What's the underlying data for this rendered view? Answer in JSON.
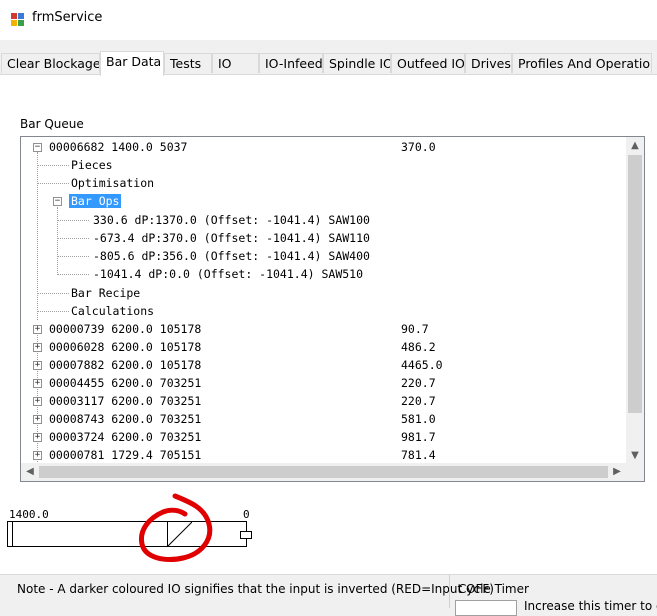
{
  "window": {
    "title": "frmService"
  },
  "tabs": [
    "Clear Blockages",
    "Bar Data",
    "Tests",
    "IO",
    "IO-Infeed",
    "Spindle IO",
    "Outfeed IO",
    "Drives",
    "Profiles And Operations"
  ],
  "active_tab": "Bar Data",
  "bar_queue": {
    "label": "Bar Queue",
    "root": {
      "text": "00006682 1400.0 5037",
      "value": "370.0"
    },
    "children": [
      "Pieces",
      "Optimisation",
      "Bar Ops",
      "Bar Recipe",
      "Calculations"
    ],
    "selected_child": "Bar Ops",
    "bar_ops": [
      "330.6 dP:1370.0 (Offset: -1041.4) SAW100",
      "-673.4 dP:370.0 (Offset: -1041.4) SAW110",
      "-805.6 dP:356.0 (Offset: -1041.4) SAW400",
      "-1041.4 dP:0.0 (Offset: -1041.4) SAW510"
    ],
    "bars": [
      {
        "text": "00000739 6200.0 105178",
        "value": "90.7"
      },
      {
        "text": "00006028 6200.0 105178",
        "value": "486.2"
      },
      {
        "text": "00007882 6200.0 105178",
        "value": "4465.0"
      },
      {
        "text": "00004455 6200.0 703251",
        "value": "220.7"
      },
      {
        "text": "00003117 6200.0 703251",
        "value": "220.7"
      },
      {
        "text": "00008743 6200.0 703251",
        "value": "581.0"
      },
      {
        "text": "00003724 6200.0 703251",
        "value": "981.7"
      },
      {
        "text": "00000781 1729.4 705151",
        "value": "781.4"
      }
    ]
  },
  "bar_graphic": {
    "left_label": "1400.0",
    "right_label": "0"
  },
  "footer": {
    "note": "Note - A darker coloured IO signifies that the input is inverted (RED=Input OFF)",
    "cycle_timer_label": "Cycle Timer",
    "cycle_hint": "Increase this timer to cyc"
  },
  "colors": {
    "selection": "#3399ff",
    "annotation": "#e00000"
  }
}
